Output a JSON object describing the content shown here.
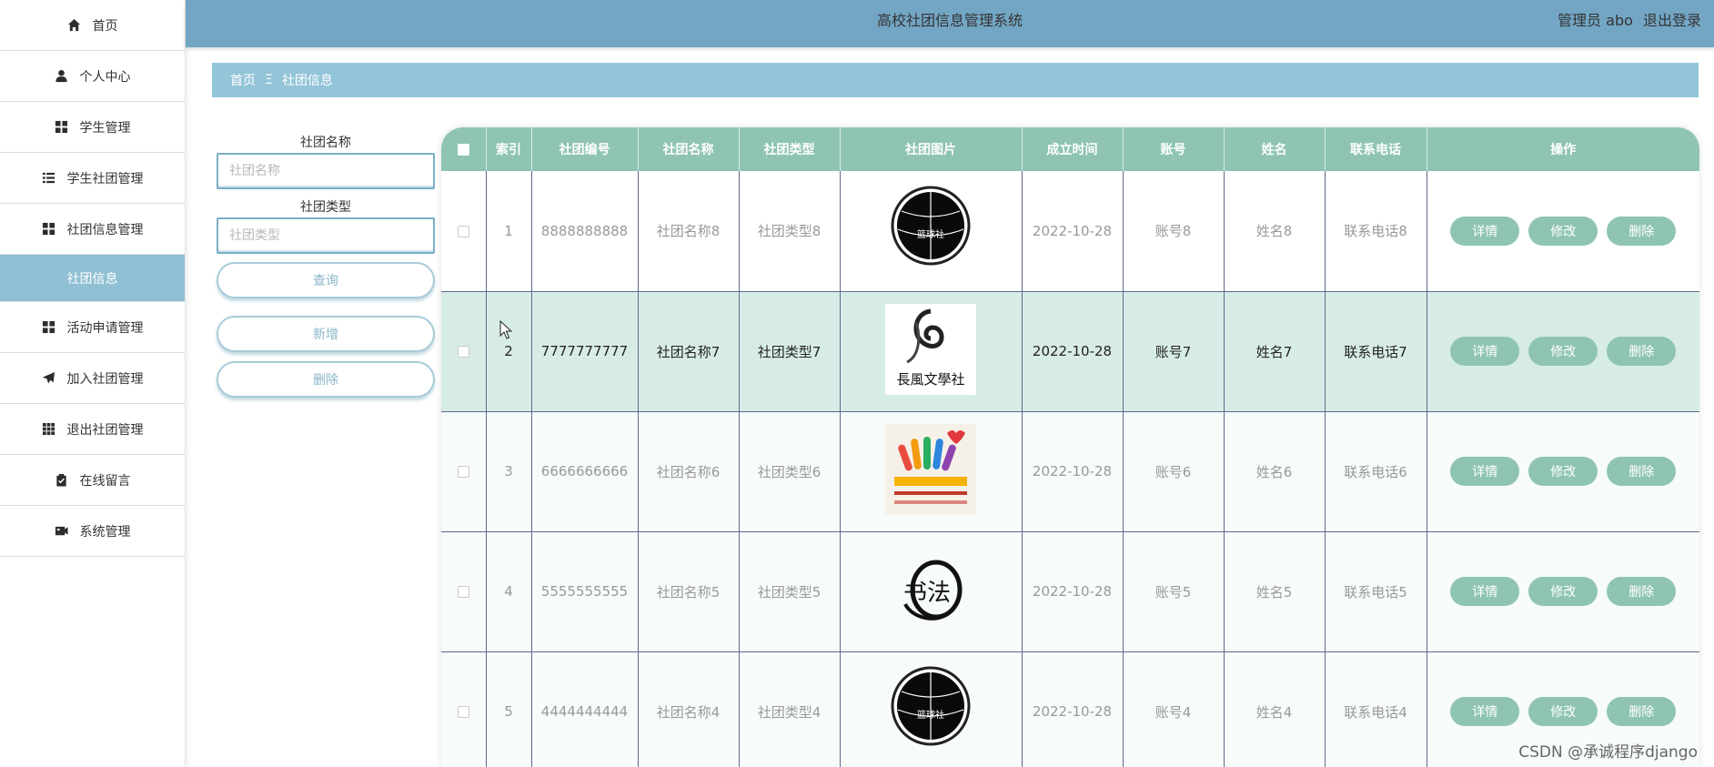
{
  "header": {
    "title": "高校社团信息管理系统",
    "user_label": "管理员 abo",
    "logout": "退出登录"
  },
  "sidebar": {
    "items": [
      {
        "label": "首页",
        "icon": "home-icon"
      },
      {
        "label": "个人中心",
        "icon": "user-icon"
      },
      {
        "label": "学生管理",
        "icon": "grid-icon"
      },
      {
        "label": "学生社团管理",
        "icon": "list-icon"
      },
      {
        "label": "社团信息管理",
        "icon": "grid-icon"
      },
      {
        "label": "社团信息",
        "icon": "",
        "active": true
      },
      {
        "label": "活动申请管理",
        "icon": "grid-icon"
      },
      {
        "label": "加入社团管理",
        "icon": "paper-plane-icon"
      },
      {
        "label": "退出社团管理",
        "icon": "apps-icon"
      },
      {
        "label": "在线留言",
        "icon": "clipboard-icon"
      },
      {
        "label": "系统管理",
        "icon": "film-icon"
      }
    ]
  },
  "breadcrumb": {
    "home": "首页",
    "separator": "Ξ",
    "current": "社团信息"
  },
  "search": {
    "name_label": "社团名称",
    "name_placeholder": "社团名称",
    "type_label": "社团类型",
    "type_placeholder": "社团类型",
    "query_button": "查询",
    "add_button": "新增",
    "delete_button": "删除"
  },
  "table": {
    "columns": [
      "索引",
      "社团编号",
      "社团名称",
      "社团类型",
      "社团图片",
      "成立时间",
      "账号",
      "姓名",
      "联系电话",
      "操作"
    ],
    "actions": {
      "detail": "详情",
      "edit": "修改",
      "delete": "删除"
    },
    "rows": [
      {
        "index": "1",
        "code": "8888888888",
        "name": "社团名称8",
        "type": "社团类型8",
        "image": "basketball-club-logo",
        "logo_text": "篮球社",
        "date": "2022-10-28",
        "account": "账号8",
        "person": "姓名8",
        "phone": "联系电话8"
      },
      {
        "index": "2",
        "code": "7777777777",
        "name": "社团名称7",
        "type": "社团类型7",
        "image": "literature-club-logo",
        "logo_text": "長風文學社",
        "date": "2022-10-28",
        "account": "账号7",
        "person": "姓名7",
        "phone": "联系电话7"
      },
      {
        "index": "3",
        "code": "6666666666",
        "name": "社团名称6",
        "type": "社团类型6",
        "image": "volunteer-club-poster",
        "logo_text": "",
        "date": "2022-10-28",
        "account": "账号6",
        "person": "姓名6",
        "phone": "联系电话6"
      },
      {
        "index": "4",
        "code": "5555555555",
        "name": "社团名称5",
        "type": "社团类型5",
        "image": "calligraphy-club-logo",
        "logo_text": "书法",
        "date": "2022-10-28",
        "account": "账号5",
        "person": "姓名5",
        "phone": "联系电话5"
      },
      {
        "index": "5",
        "code": "4444444444",
        "name": "社团名称4",
        "type": "社团类型4",
        "image": "basketball-club-logo",
        "logo_text": "篮球社",
        "date": "2022-10-28",
        "account": "账号4",
        "person": "姓名4",
        "phone": "联系电话4"
      }
    ]
  },
  "watermark": "CSDN @承诚程序django",
  "colors": {
    "topbar": "#73a6c4",
    "breadcrumb": "#93c5d9",
    "accent": "#8fc4b5",
    "sidebar_active": "#8fc0d4"
  }
}
